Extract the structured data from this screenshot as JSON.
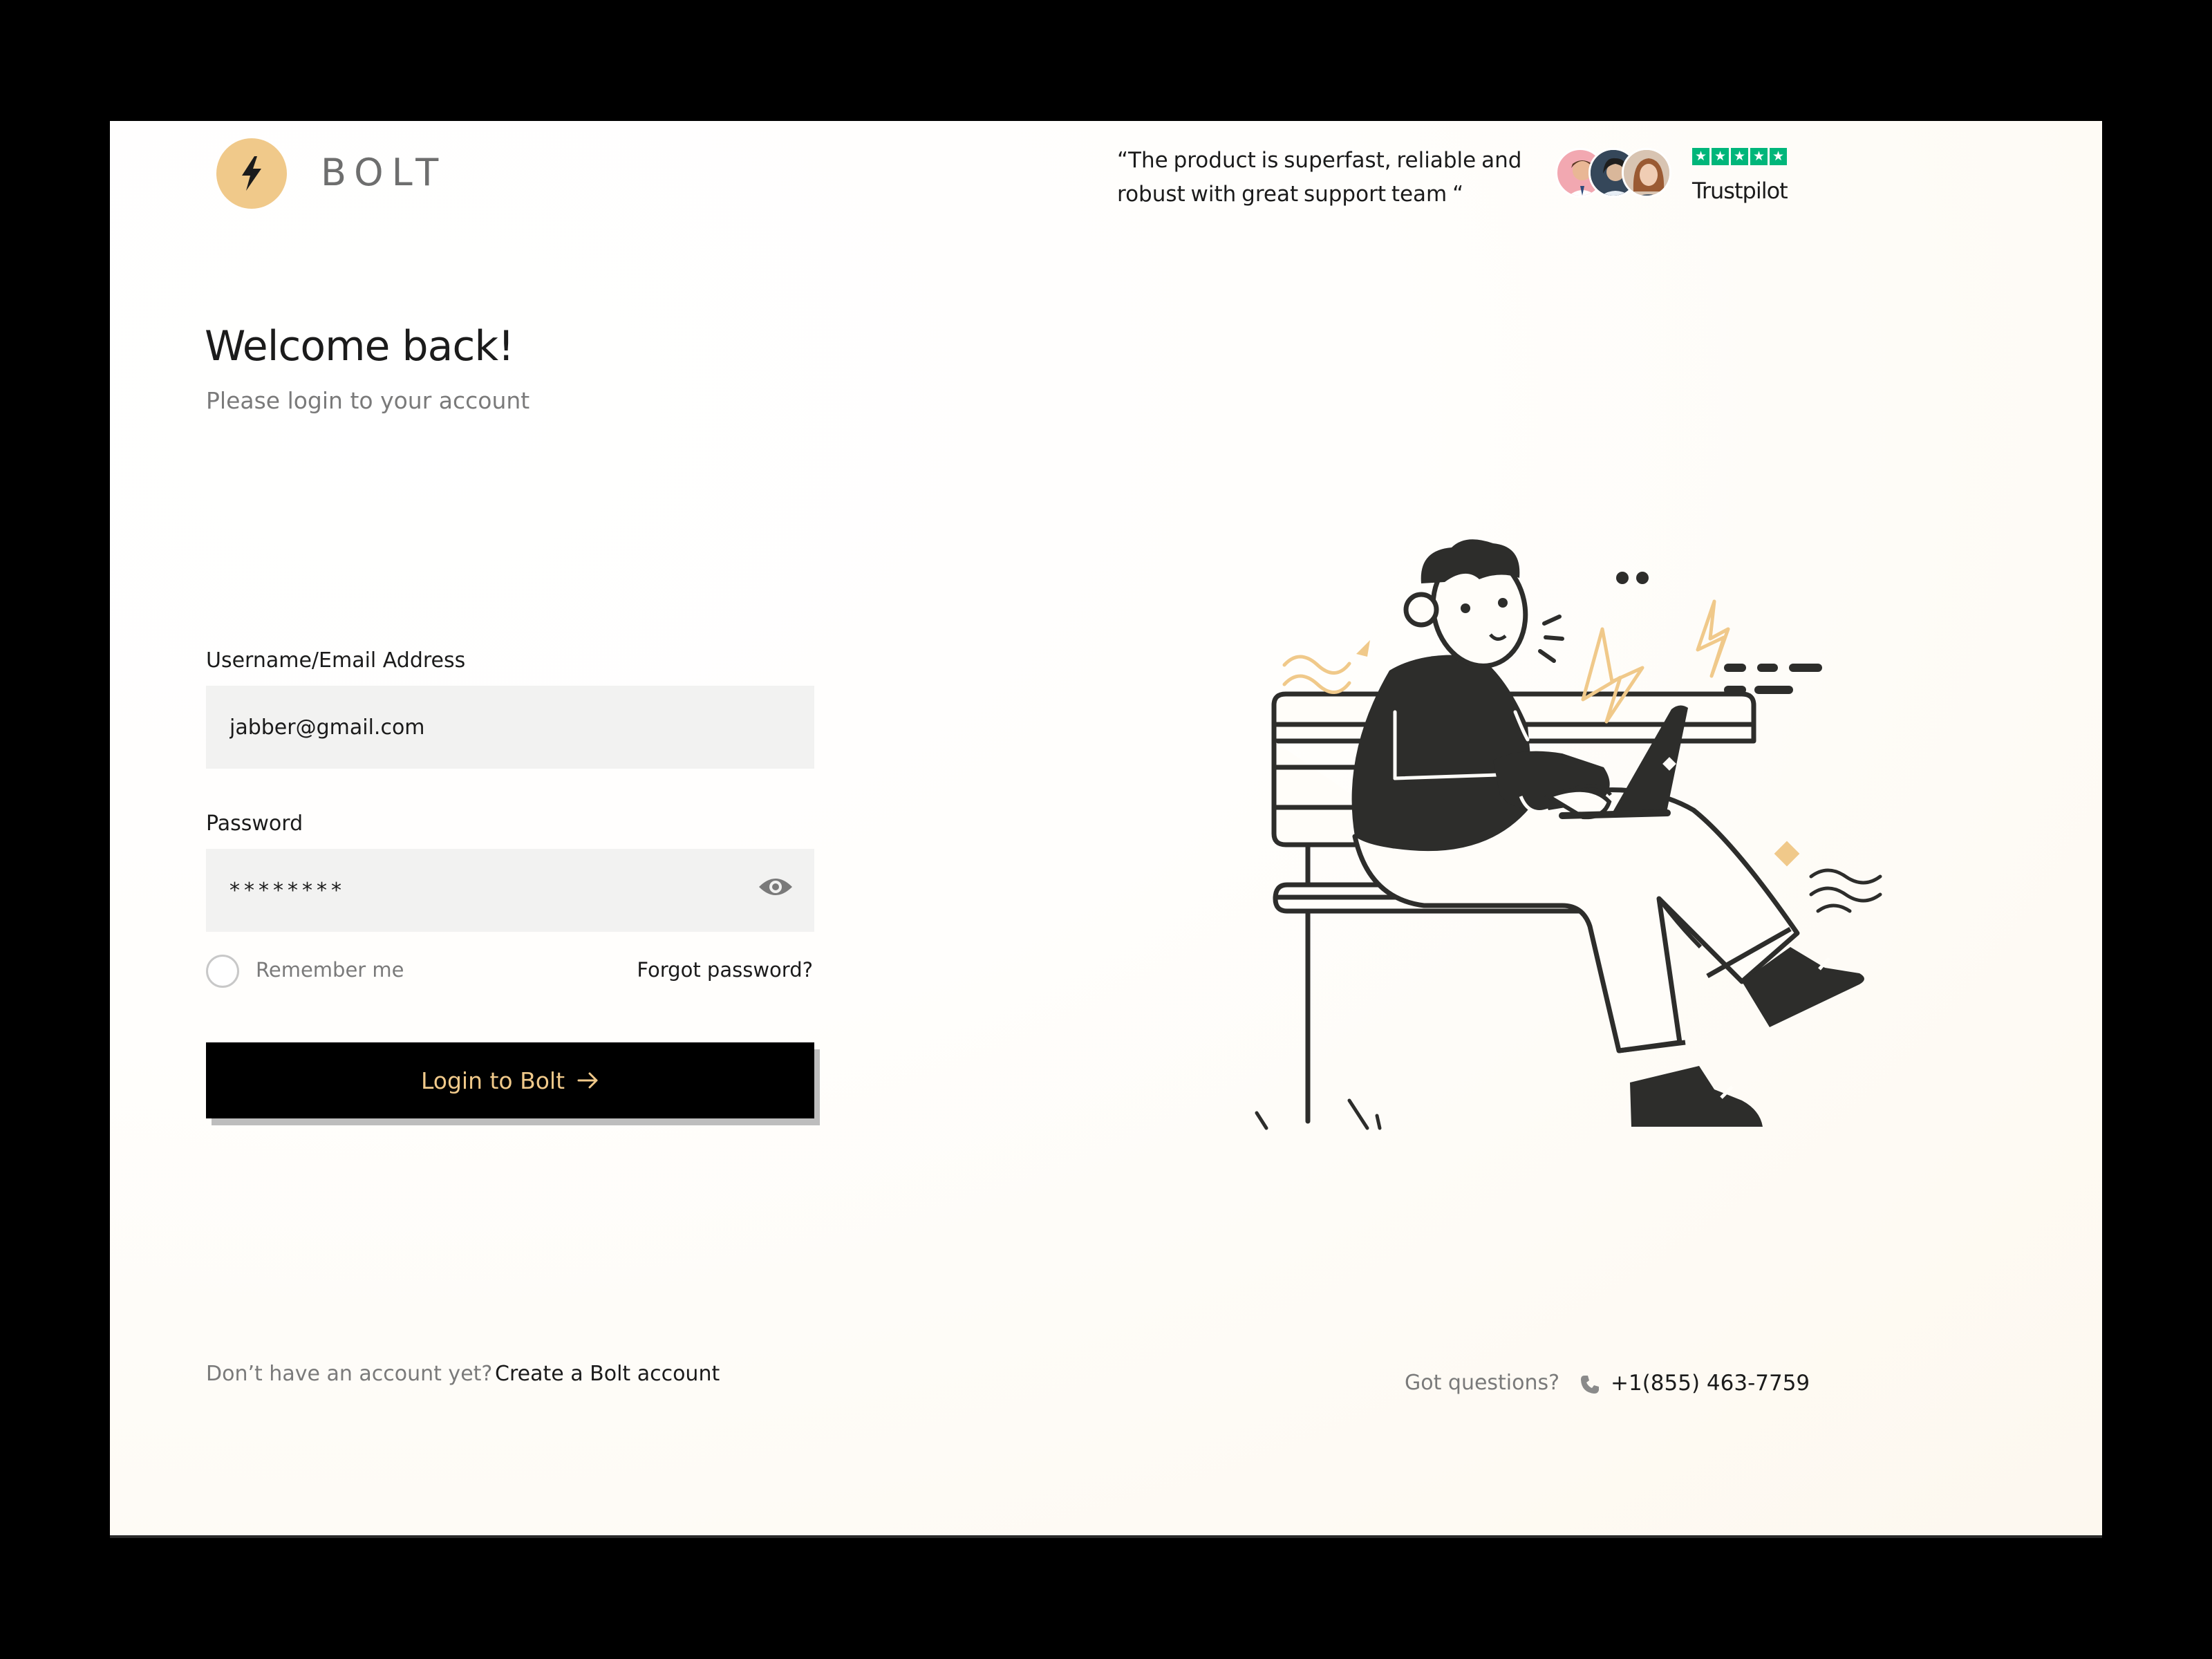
{
  "brand": {
    "name": "BOLT",
    "logo_icon": "lightning-bolt-icon",
    "accent_color": "#f0c98a"
  },
  "testimonial": {
    "quote": "“The product is superfast, reliable and robust with great support team “",
    "rating_stars": 5,
    "rating_source": "Trustpilot",
    "rating_color": "#00b67a"
  },
  "form": {
    "title": "Welcome back!",
    "subtitle": "Please login to your account",
    "username_label": "Username/Email Address",
    "username_value": "jabber@gmail.com",
    "password_label": "Password",
    "password_value": "********",
    "remember_label": "Remember me",
    "forgot_label": "Forgot password?",
    "login_label": "Login to Bolt"
  },
  "footer": {
    "signup_prompt": "Don’t have an account yet?",
    "signup_link": "Create a Bolt account",
    "questions_label": "Got questions?",
    "phone": "+1(855) 463-7759"
  }
}
